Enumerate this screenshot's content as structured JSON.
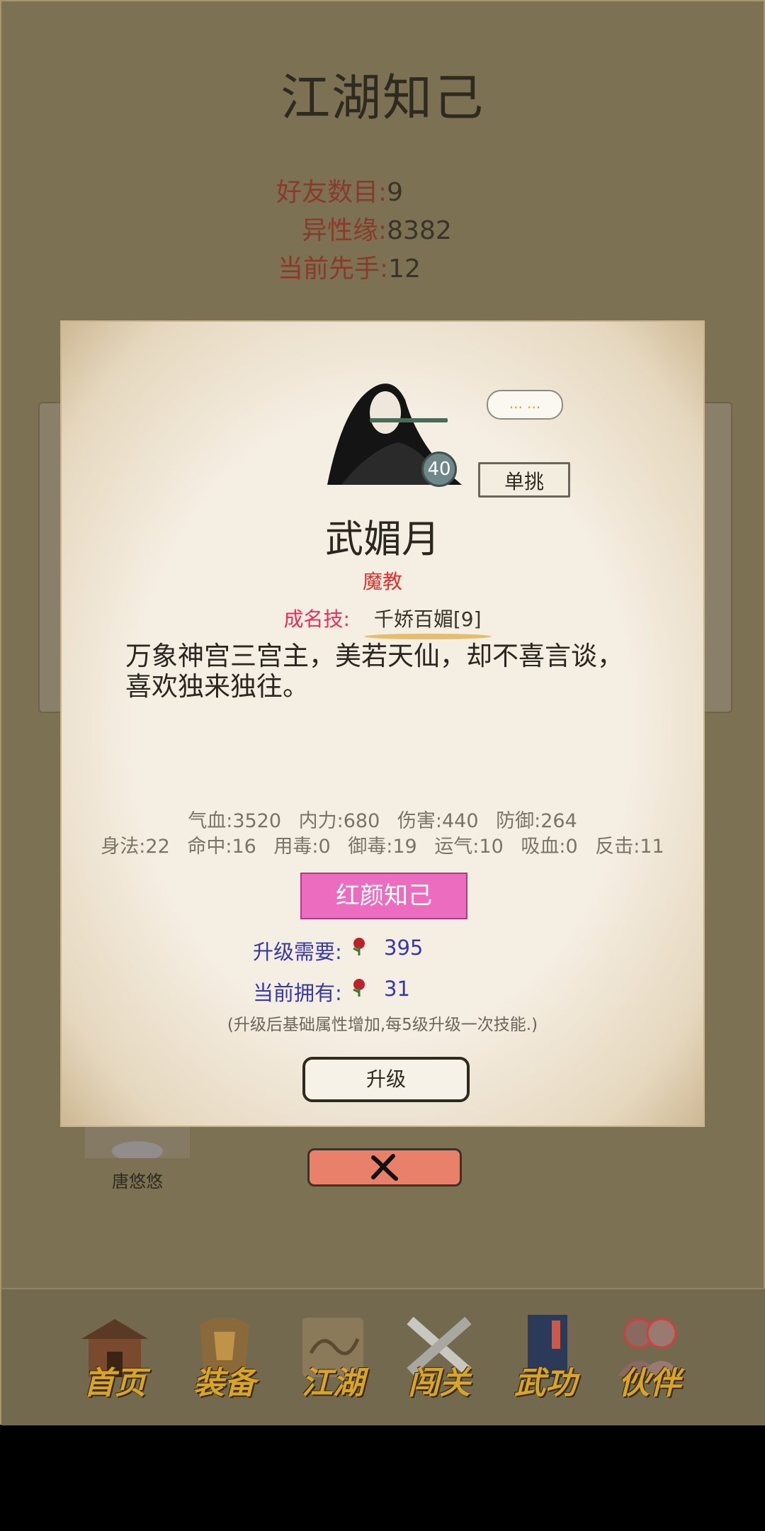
{
  "header": {
    "title": "江湖知己"
  },
  "stats": [
    {
      "key": "好友数目",
      "value": "9"
    },
    {
      "key": "异性缘",
      "value": "8382"
    },
    {
      "key": "当前先手",
      "value": "12"
    }
  ],
  "background": {
    "friend_name": "唐悠悠"
  },
  "dialog": {
    "level": "40",
    "bubble": "... ...",
    "duel_label": "单挑",
    "name": "武媚月",
    "faction": "魔教",
    "skill_label": "成名技:",
    "skill_name": "千娇百媚[9]",
    "description": "万象神宫三宫主，美若天仙，却不喜言谈，喜欢独来独往。",
    "attrs_row1": [
      "气血:3520",
      "内力:680",
      "伤害:440",
      "防御:264"
    ],
    "attrs_row2": [
      "身法:22",
      "命中:16",
      "用毒:0",
      "御毒:19",
      "运气:10",
      "吸血:0",
      "反击:11"
    ],
    "rank_label": "红颜知己",
    "upgrade_need_label": "升级需要:",
    "upgrade_need_value": "395",
    "owned_label": "当前拥有:",
    "owned_value": "31",
    "hint": "(升级后基础属性增加,每5级升级一次技能.)",
    "upgrade_button": "升级"
  },
  "nav": [
    {
      "label": "首页",
      "icon": "house-icon"
    },
    {
      "label": "装备",
      "icon": "armor-icon"
    },
    {
      "label": "江湖",
      "icon": "scroll-map-icon"
    },
    {
      "label": "闯关",
      "icon": "crossed-swords-icon"
    },
    {
      "label": "武功",
      "icon": "book-icon"
    },
    {
      "label": "伙伴",
      "icon": "partners-icon"
    }
  ],
  "colors": {
    "background": "#7d7153",
    "dialog": "#f5eee2",
    "rank_button": "#ec6cc0",
    "accent_red": "#e3302a"
  }
}
